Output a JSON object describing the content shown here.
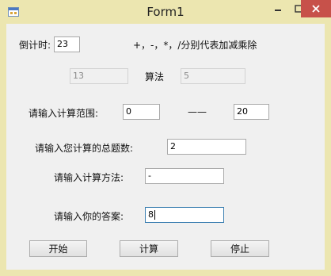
{
  "window": {
    "title": "Form1"
  },
  "titlebar": {
    "minimize": "□",
    "maximize": "□",
    "close": "✕"
  },
  "timer": {
    "label": "倒计时:",
    "value": "23"
  },
  "hint": "+，-，*，/分别代表加减乘除",
  "problem": {
    "left": "13",
    "op_label": "算法",
    "right": "5"
  },
  "range": {
    "label": "请输入计算范围:",
    "from": "0",
    "dash": "——",
    "to": "20"
  },
  "total": {
    "label": "请输入您计算的总题数:",
    "value": "2"
  },
  "method": {
    "label": "请输入计算方法:",
    "value": "-"
  },
  "answer": {
    "label": "请输入你的答案:",
    "value": "8"
  },
  "buttons": {
    "start": "开始",
    "calc": "计算",
    "stop": "停止"
  }
}
